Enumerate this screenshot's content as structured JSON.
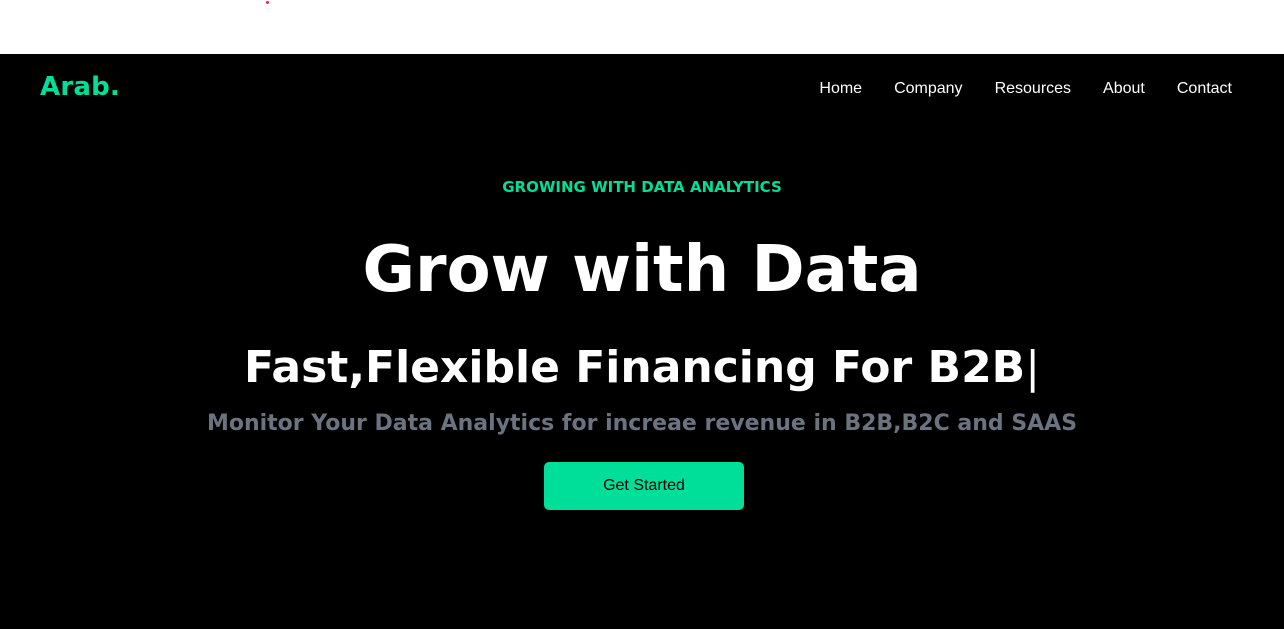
{
  "brand": {
    "logo": "Arab.",
    "accent_color": "#00df9a"
  },
  "nav": {
    "items": [
      {
        "label": "Home"
      },
      {
        "label": "Company"
      },
      {
        "label": "Resources"
      },
      {
        "label": "About"
      },
      {
        "label": "Contact"
      }
    ]
  },
  "hero": {
    "eyebrow": "GROWING WITH DATA ANALYTICS",
    "title": "Grow with Data",
    "subtitle_text": "Fast,Flexible Financing For B2B",
    "subtitle_cursor": "|",
    "description": "Monitor Your Data Analytics for increae revenue in B2B,B2C and SAAS",
    "cta_label": "Get Started"
  },
  "colors": {
    "background": "#000000",
    "text": "#ffffff",
    "muted": "#6b7280"
  }
}
